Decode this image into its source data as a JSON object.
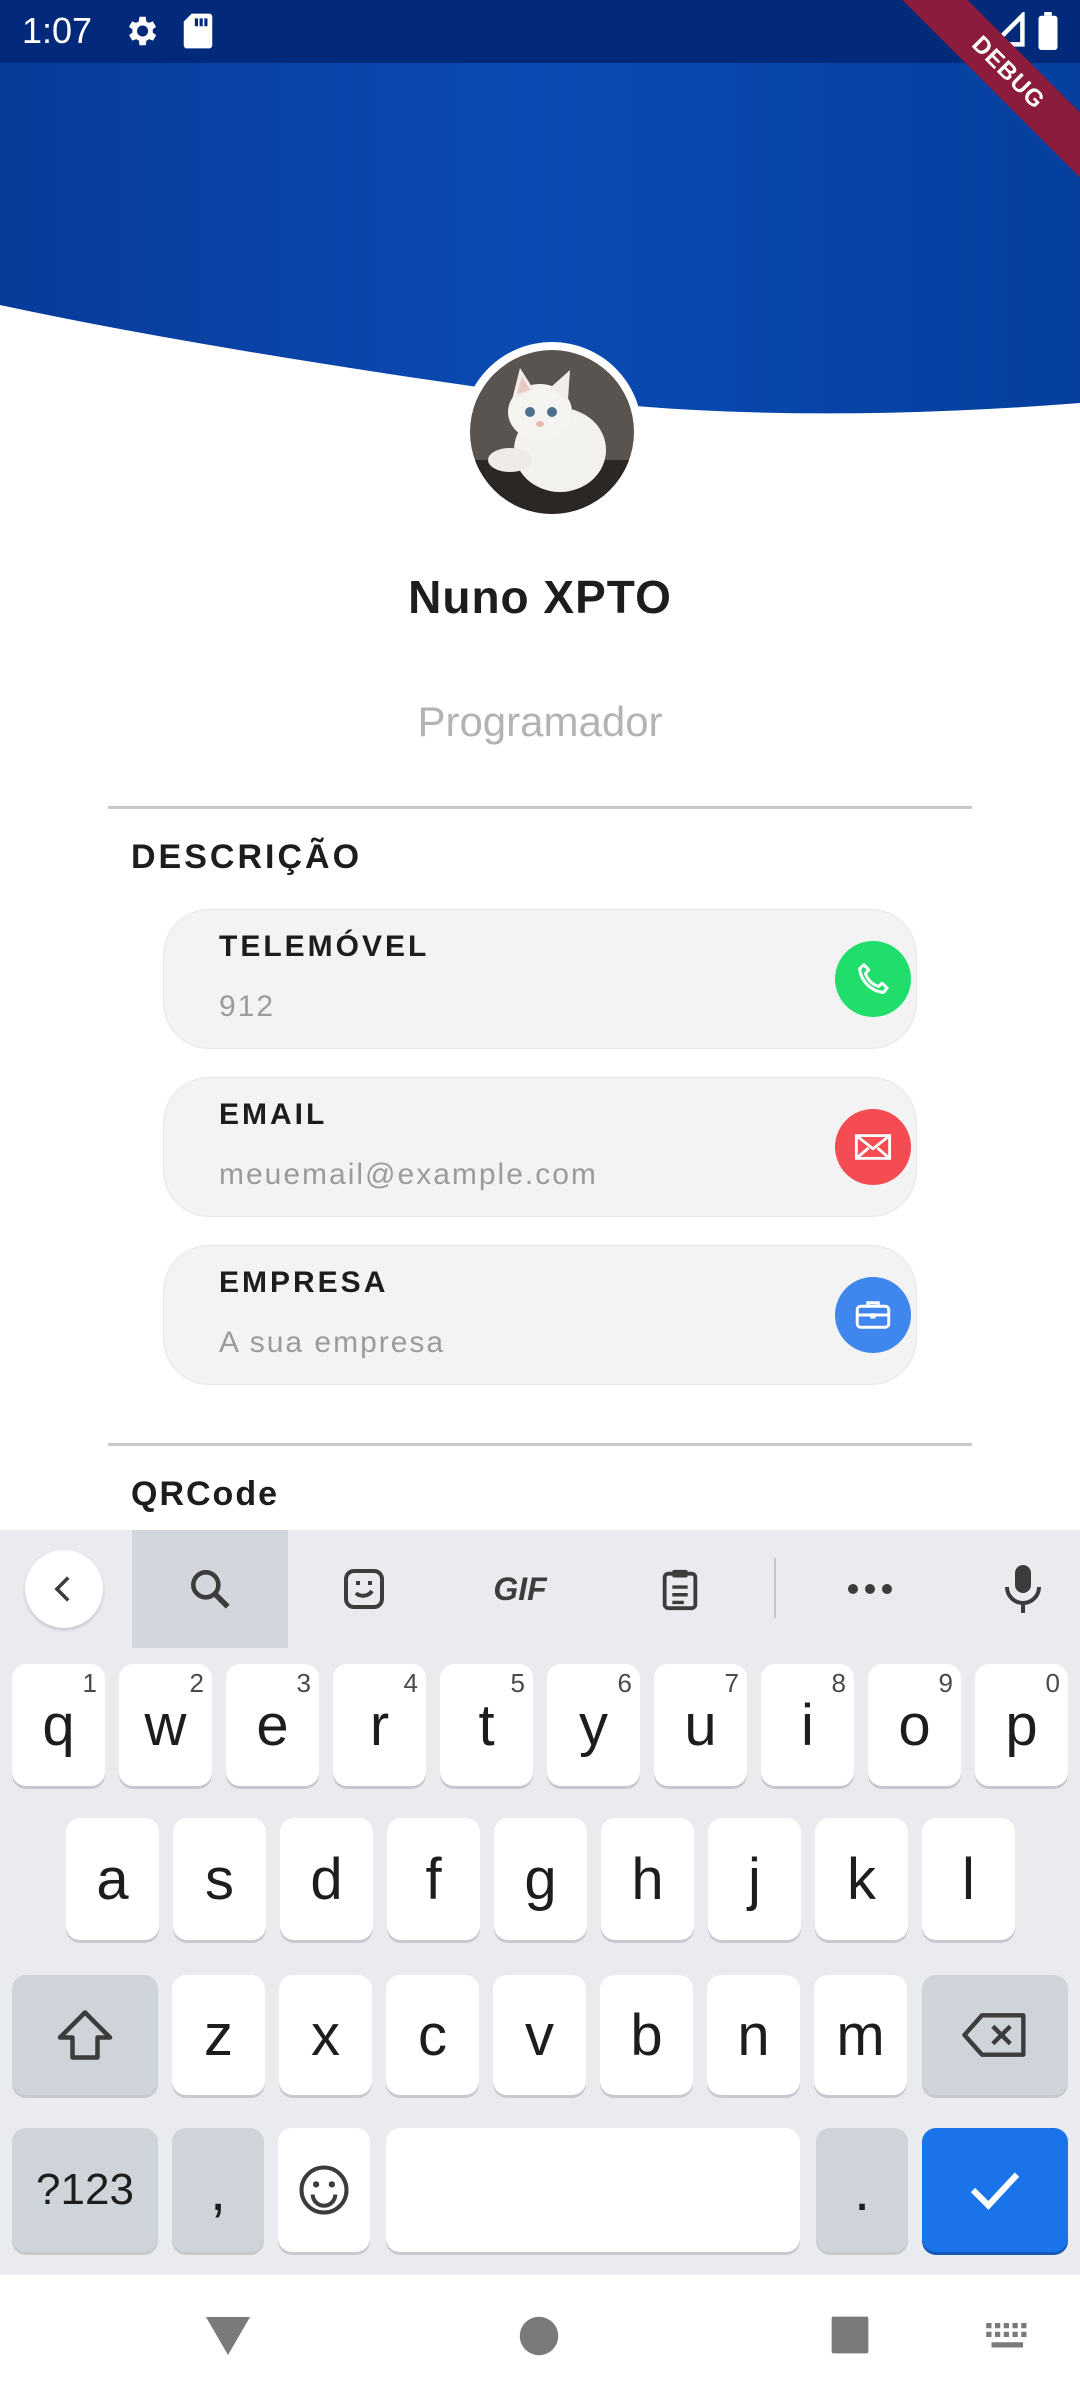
{
  "status_bar": {
    "time": "1:07"
  },
  "debug_banner": "DEBUG",
  "profile": {
    "name": "Nuno XPTO",
    "role": "Programador"
  },
  "sections": {
    "description_title": "DESCRIÇÃO",
    "qrcode_title": "QRCode"
  },
  "cards": [
    {
      "label": "TELEMÓVEL",
      "value": "912",
      "icon": "phone-icon",
      "color": "#1fde6c"
    },
    {
      "label": "EMAIL",
      "value": "meuemail@example.com",
      "icon": "mail-icon",
      "color": "#f44c52"
    },
    {
      "label": "EMPRESA",
      "value": "A sua empresa",
      "icon": "briefcase-icon",
      "color": "#3f86ee"
    }
  ],
  "keyboard": {
    "toolbar": [
      "back-icon",
      "search-icon",
      "sticker-icon",
      "GIF",
      "clipboard-icon",
      "more-icon",
      "mic-icon"
    ],
    "row1": [
      {
        "k": "q",
        "n": "1"
      },
      {
        "k": "w",
        "n": "2"
      },
      {
        "k": "e",
        "n": "3"
      },
      {
        "k": "r",
        "n": "4"
      },
      {
        "k": "t",
        "n": "5"
      },
      {
        "k": "y",
        "n": "6"
      },
      {
        "k": "u",
        "n": "7"
      },
      {
        "k": "i",
        "n": "8"
      },
      {
        "k": "o",
        "n": "9"
      },
      {
        "k": "p",
        "n": "0"
      }
    ],
    "row2": [
      "a",
      "s",
      "d",
      "f",
      "g",
      "h",
      "j",
      "k",
      "l"
    ],
    "row3": [
      "z",
      "x",
      "c",
      "v",
      "b",
      "n",
      "m"
    ],
    "sym_label": "?123",
    "comma": ",",
    "period": "."
  },
  "colors": {
    "header_dark": "#032a7a",
    "header_mid": "#0748ad",
    "accent": "#1a73e8"
  }
}
